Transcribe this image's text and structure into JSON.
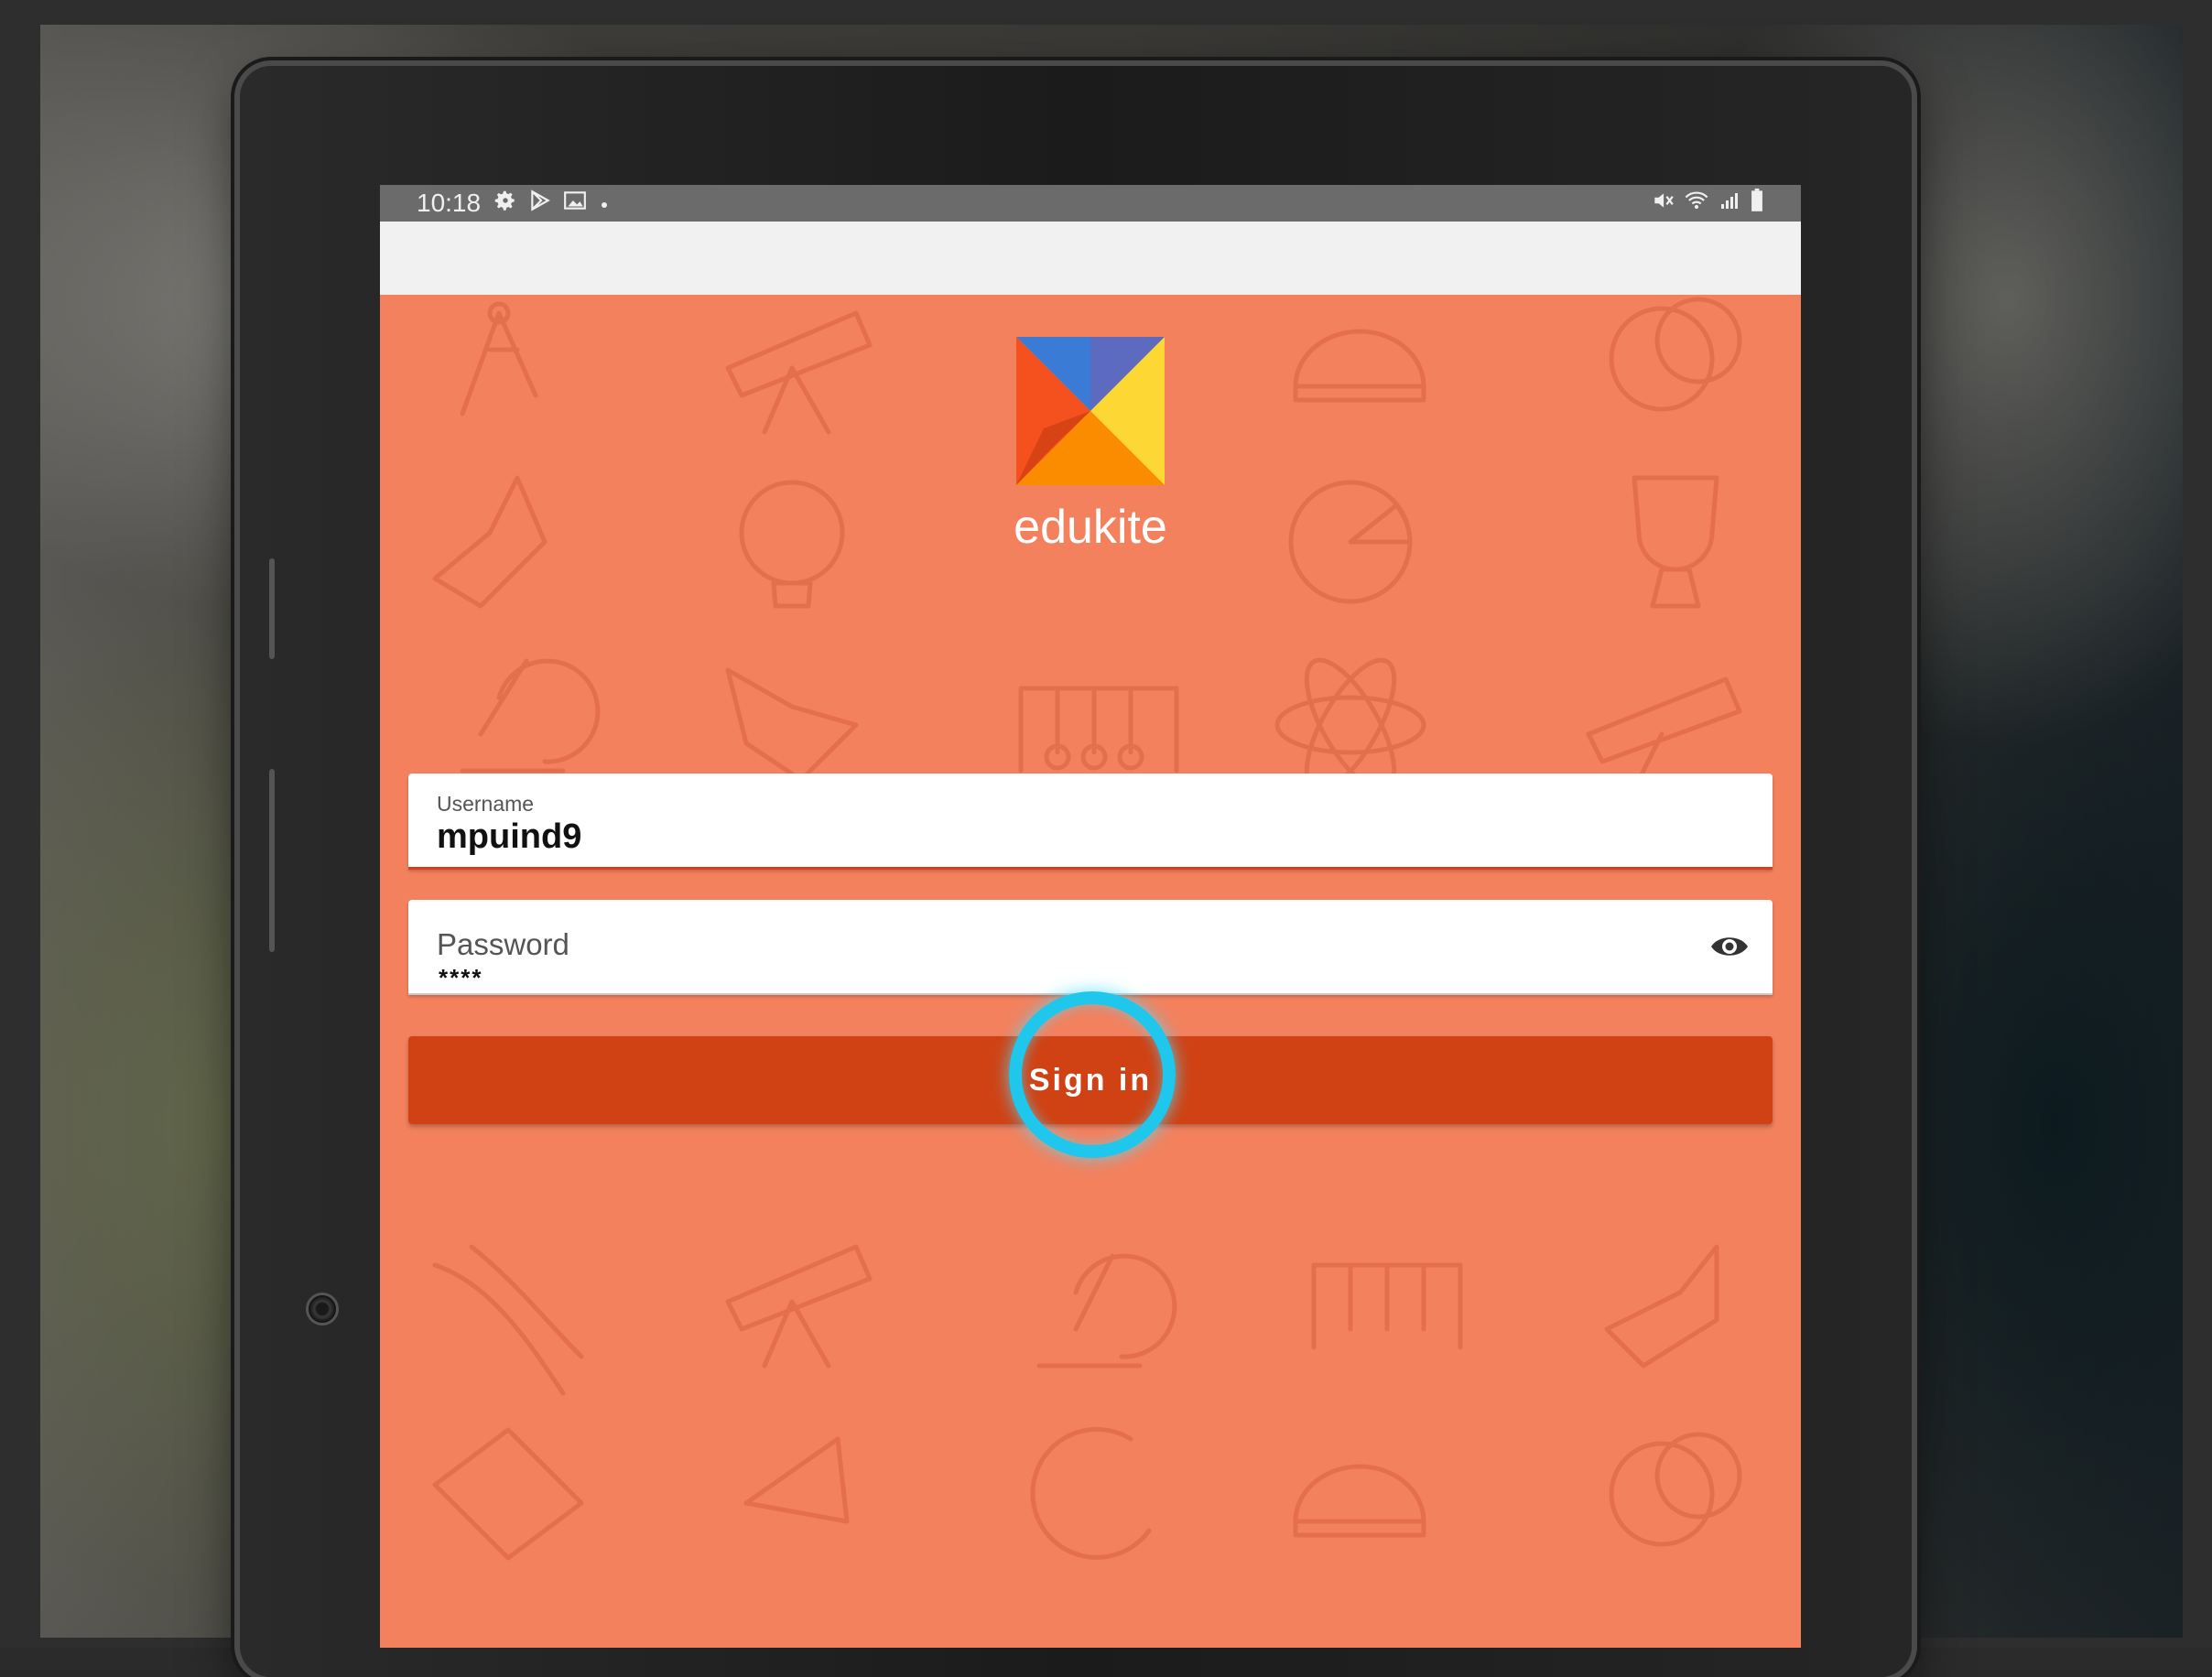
{
  "status_bar": {
    "time": "10:18",
    "left_icons": [
      "gear-icon",
      "play-store-icon",
      "image-icon",
      "dot-icon"
    ],
    "right_icons": [
      "mute-icon",
      "wifi-icon",
      "signal-icon",
      "battery-icon"
    ]
  },
  "app": {
    "brand_name": "edukite",
    "logo_icon": "edukite-logo-icon",
    "colors": {
      "background": "#f3815e",
      "button": "#d04214",
      "focus_underline": "#d9401a",
      "tap_indicator": "#1fc7ec"
    }
  },
  "login_form": {
    "username": {
      "label": "Username",
      "value": "mpuind9"
    },
    "password": {
      "label": "Password",
      "masked_value": "****",
      "toggle_icon": "eye-icon"
    },
    "submit_label": "Sign in"
  }
}
